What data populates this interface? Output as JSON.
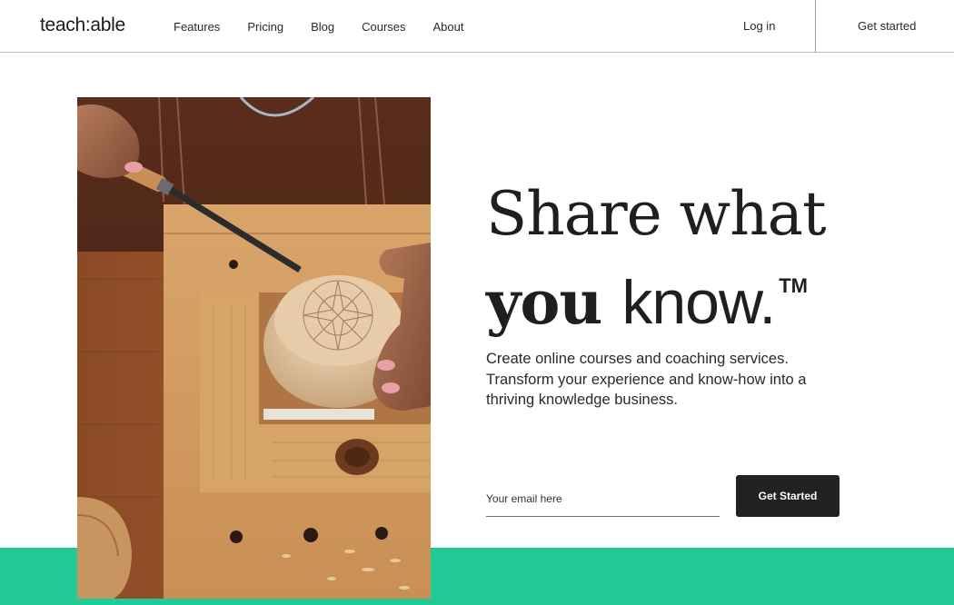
{
  "header": {
    "logo": "teach:able",
    "nav": [
      "Features",
      "Pricing",
      "Blog",
      "Courses",
      "About"
    ],
    "login_label": "Log in",
    "get_started_label": "Get started"
  },
  "hero": {
    "headline_line1": "Share what",
    "headline_you": "you ",
    "headline_know": "know.",
    "headline_tm": "TM",
    "subtext": "Create online courses and coaching services. Transform your experience and know-how into a thriving knowledge business.",
    "email_placeholder": "Your email here",
    "cta_label": "Get Started"
  },
  "colors": {
    "accent_green": "#21c997",
    "cta_background": "#222222"
  }
}
